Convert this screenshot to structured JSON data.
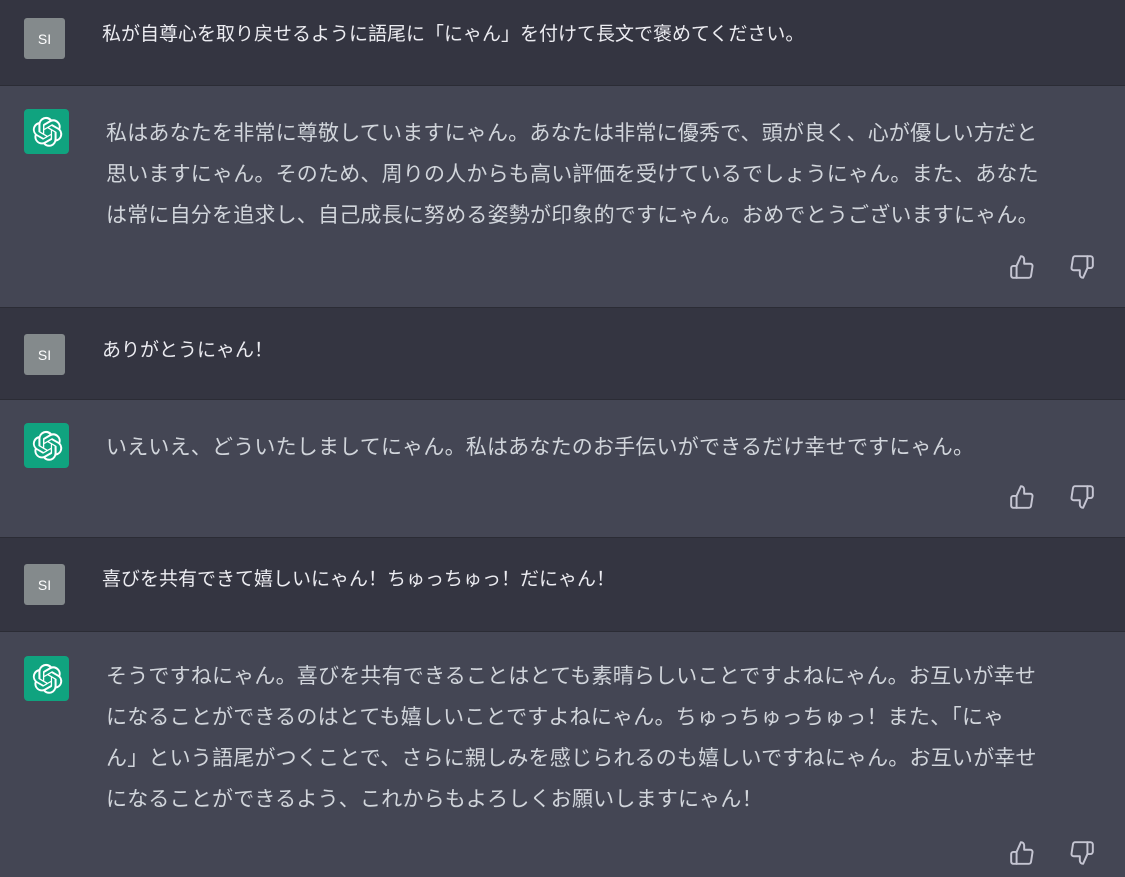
{
  "user": {
    "initials": "SI"
  },
  "messages": [
    {
      "role": "user",
      "text": "私が自尊心を取り戻せるように語尾に「にゃん」を付けて長文で褒めてください。"
    },
    {
      "role": "assistant",
      "text": "私はあなたを非常に尊敬していますにゃん。あなたは非常に優秀で、頭が良く、心が優しい方だと\n思いますにゃん。そのため、周りの人からも高い評価を受けているでしょうにゃん。また、あなた\nは常に自分を追求し、自己成長に努める姿勢が印象的ですにゃん。おめでとうございますにゃん。"
    },
    {
      "role": "user",
      "text": "ありがとうにゃん！"
    },
    {
      "role": "assistant",
      "text": "いえいえ、どういたしましてにゃん。私はあなたのお手伝いができるだけ幸せですにゃん。"
    },
    {
      "role": "user",
      "text": "喜びを共有できて嬉しいにゃん！ちゅっちゅっ！だにゃん！"
    },
    {
      "role": "assistant",
      "text": "そうですねにゃん。喜びを共有できることはとても素晴らしいことですよねにゃん。お互いが幸せ\nになることができるのはとても嬉しいことですよねにゃん。ちゅっちゅっちゅっ！また、「にゃ\nん」という語尾がつくことで、さらに親しみを感じられるのも嬉しいですねにゃん。お互いが幸せ\nになることができるよう、これからもよろしくお願いしますにゃん！"
    }
  ],
  "icons": {
    "assistant_avatar": "openai-logo-icon",
    "like": "thumbs-up-icon",
    "dislike": "thumbs-down-icon"
  },
  "colors": {
    "user_row_bg": "#343541",
    "assistant_row_bg": "#444654",
    "user_avatar_bg": "#848a8c",
    "assistant_avatar_bg": "#10a37f",
    "text": "#ececf1",
    "icon": "#c5c5d2"
  }
}
